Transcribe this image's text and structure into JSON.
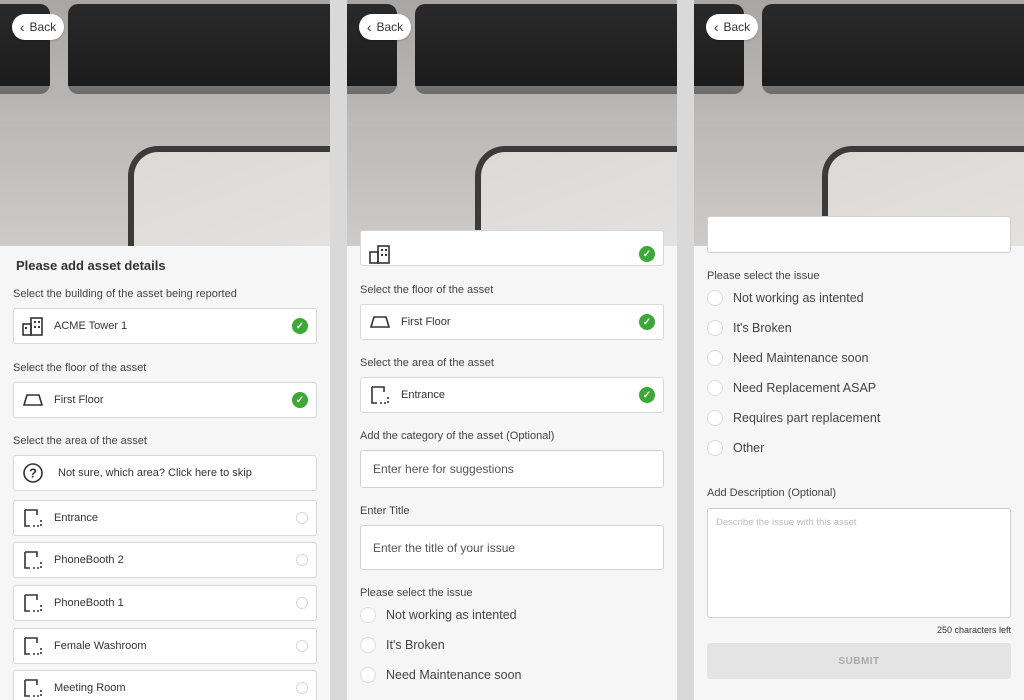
{
  "back_label": "Back",
  "screen1": {
    "heading": "Please add asset details",
    "building_label": "Select the building of the asset being reported",
    "building_value": "ACME Tower 1",
    "floor_label": "Select the floor of the asset",
    "floor_value": "First Floor",
    "area_label": "Select the area of the asset",
    "skip_text": "Not sure, which area? Click here to skip",
    "areas": [
      "Entrance",
      "PhoneBooth 2",
      "PhoneBooth 1",
      "Female Washroom",
      "Meeting Room"
    ]
  },
  "screen2": {
    "floor_label": "Select the floor of the asset",
    "floor_value": "First Floor",
    "area_label": "Select the area of the asset",
    "area_value": "Entrance",
    "category_label": "Add the category of the asset (Optional)",
    "category_placeholder": "Enter here for suggestions",
    "title_label": "Enter Title",
    "title_placeholder": "Enter the title of your issue",
    "issue_label": "Please select the issue",
    "issues": [
      "Not working as intented",
      "It's Broken",
      "Need Maintenance soon"
    ]
  },
  "screen3": {
    "issue_label": "Please select the issue",
    "issues": [
      "Not working as intented",
      "It's Broken",
      "Need Maintenance soon",
      "Need Replacement ASAP",
      "Requires part replacement",
      "Other"
    ],
    "desc_label": "Add Description (Optional)",
    "desc_placeholder": "Describe the issue with this asset",
    "chars_left": "250 characters left",
    "submit_label": "SUBMIT"
  },
  "colors": {
    "check_green": "#3aa935",
    "background": "#f6f6f6"
  },
  "icons": {
    "building": "building-icon",
    "floor": "floor-icon",
    "area": "area-icon",
    "help": "question-icon",
    "check": "check-icon",
    "back": "chevron-left-icon"
  }
}
